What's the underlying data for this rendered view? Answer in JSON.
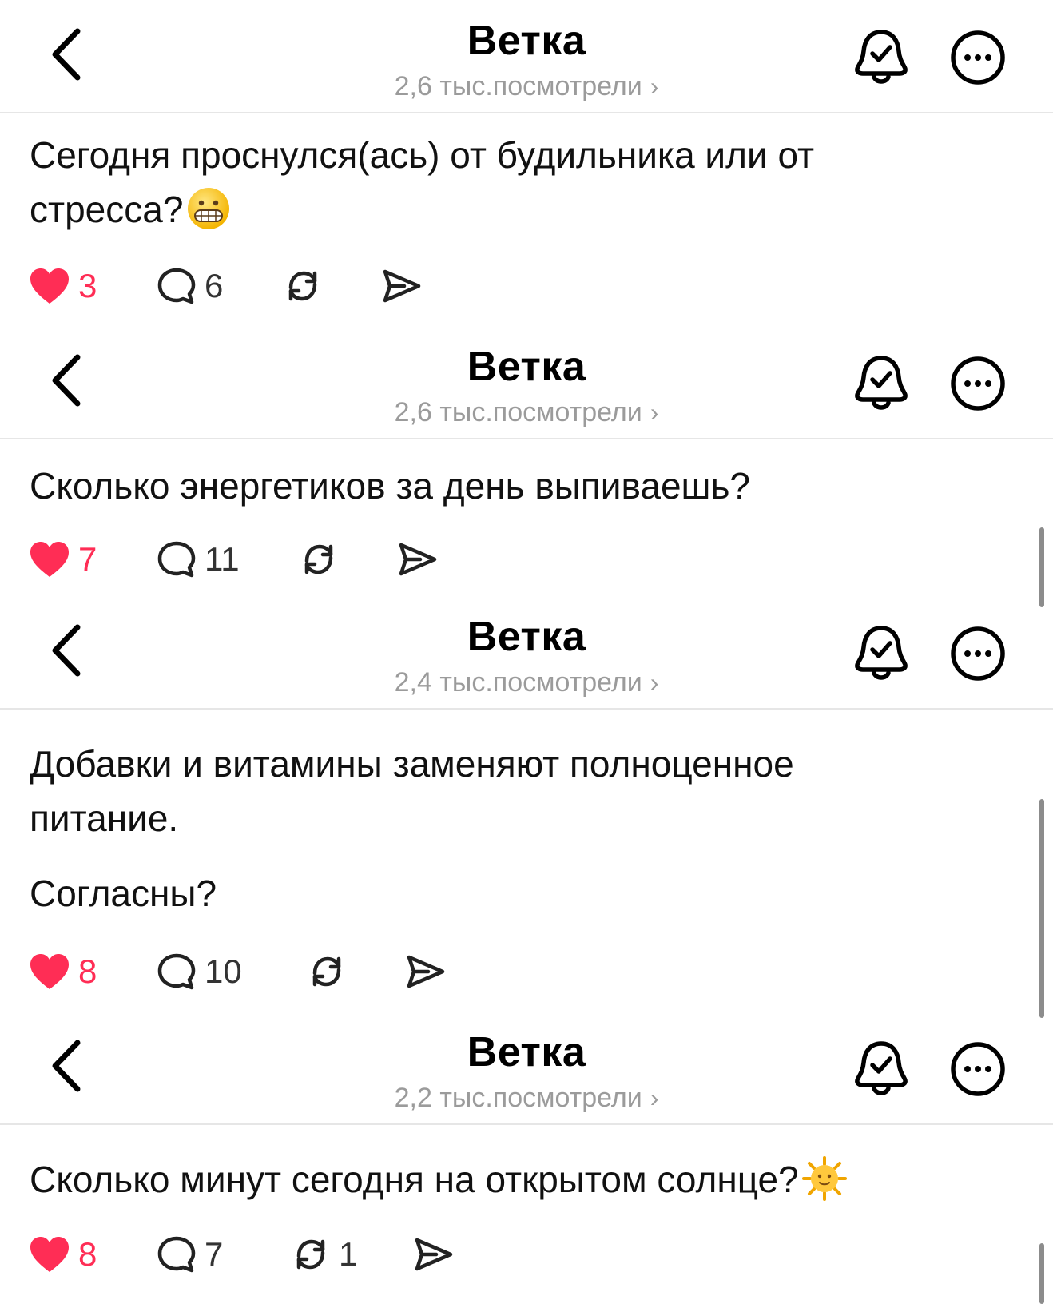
{
  "threads": [
    {
      "title": "Ветка",
      "views": "2,6 тыс.посмотрели",
      "post_lines": [
        "Сегодня проснулся(ась) от будильника или от",
        "стресса?"
      ],
      "emoji": "grimacing-face-emoji",
      "likes": "3",
      "comments": "6",
      "reposts": ""
    },
    {
      "title": "Ветка",
      "views": "2,6 тыс.посмотрели",
      "post_lines": [
        "Сколько энергетиков за день выпиваешь?"
      ],
      "likes": "7",
      "comments": "11",
      "reposts": ""
    },
    {
      "title": "Ветка",
      "views": "2,4 тыс.посмотрели",
      "post_lines": [
        "Добавки и витамины заменяют полноценное",
        "питание.",
        "",
        "Согласны?"
      ],
      "likes": "8",
      "comments": "10",
      "reposts": ""
    },
    {
      "title": "Ветка",
      "views": "2,2 тыс.посмотрели",
      "post_lines": [
        "Сколько минут сегодня на открытом солнце?"
      ],
      "emoji": "sun-with-face-emoji",
      "likes": "8",
      "comments": "7",
      "reposts": "1"
    }
  ],
  "icons": {
    "back": "chevron-left-icon",
    "bell": "bell-check-icon",
    "more": "ellipsis-circle-icon",
    "like": "heart-filled-icon",
    "comment": "speech-bubble-icon",
    "repost": "repost-arrows-icon",
    "share": "paper-plane-icon"
  },
  "colors": {
    "like_active": "#ff2d55",
    "subtitle": "#9b9b9b",
    "divider": "#e6e6e6"
  }
}
